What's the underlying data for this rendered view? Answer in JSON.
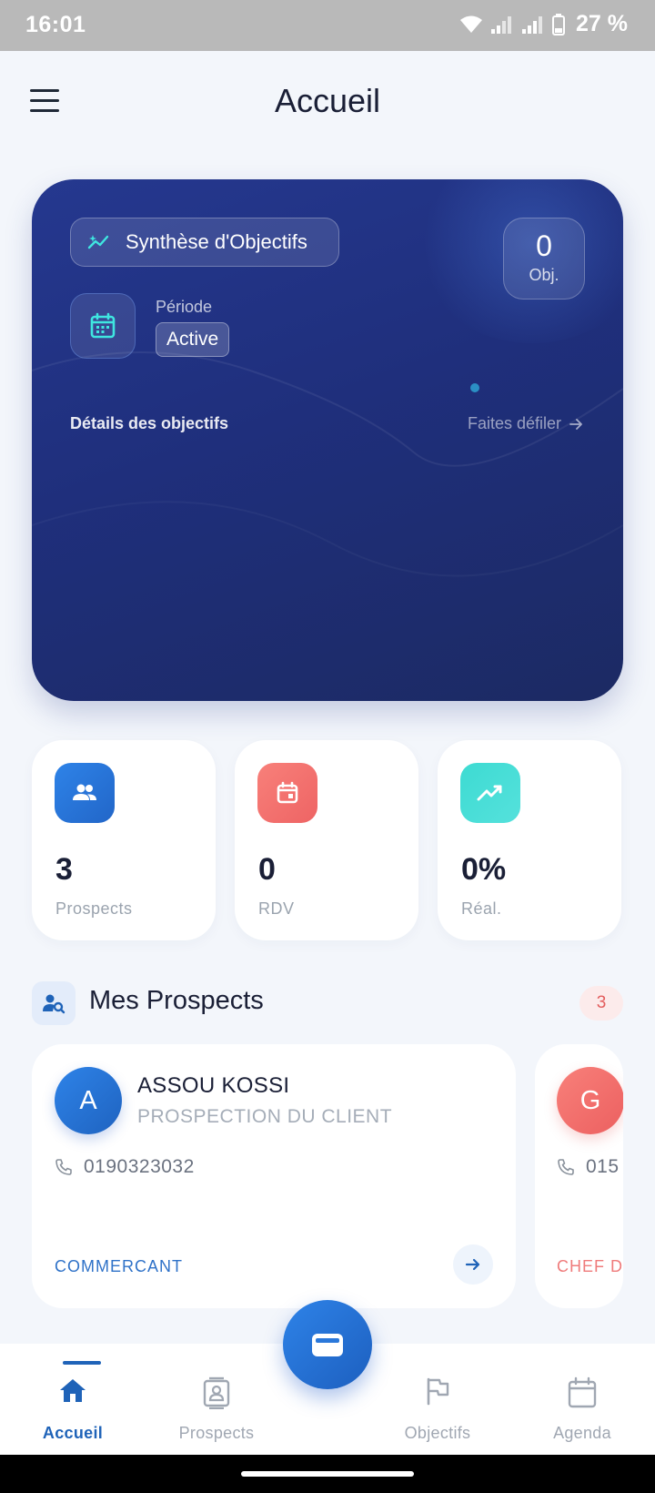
{
  "status_bar": {
    "time": "16:01",
    "battery": "27 %"
  },
  "header": {
    "title": "Accueil"
  },
  "hero": {
    "badge_label": "Synthèse d'Objectifs",
    "obj_count": "0",
    "obj_label": "Obj.",
    "period_label": "Période",
    "period_value": "Active",
    "details_label": "Détails des objectifs",
    "scroll_hint": "Faites défiler"
  },
  "stats": [
    {
      "value": "3",
      "label": "Prospects",
      "icon": "users-icon"
    },
    {
      "value": "0",
      "label": "RDV",
      "icon": "calendar-icon"
    },
    {
      "value": "0%",
      "label": "Réal.",
      "icon": "trending-up-icon"
    }
  ],
  "prospects_section": {
    "title": "Mes Prospects",
    "count": "3"
  },
  "prospects": [
    {
      "initial": "A",
      "name": "ASSOU KOSSI",
      "subtitle": "PROSPECTION DU CLIENT",
      "phone": "0190323032",
      "role": "COMMERCANT"
    },
    {
      "initial": "G",
      "name": "",
      "subtitle": "",
      "phone": "015",
      "role": "CHEF D'"
    }
  ],
  "bottom_nav": [
    {
      "label": "Accueil",
      "icon": "home-icon",
      "active": true
    },
    {
      "label": "Prospects",
      "icon": "contact-card-icon",
      "active": false
    },
    {
      "label": "Objectifs",
      "icon": "flag-icon",
      "active": false
    },
    {
      "label": "Agenda",
      "icon": "calendar-icon",
      "active": false
    }
  ],
  "colors": {
    "primary": "#1f63b8",
    "hero_bg": "#22347f",
    "accent_cyan": "#3fe6e0",
    "stat_blue": "#2e7fe0",
    "stat_coral": "#f26f6f",
    "stat_teal": "#3ed6cf"
  }
}
